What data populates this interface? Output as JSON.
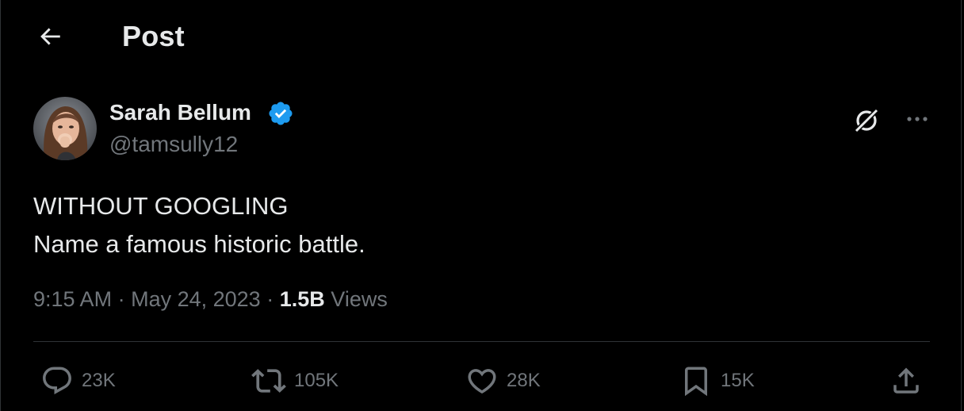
{
  "header": {
    "title": "Post",
    "back_icon": "arrow-left-icon"
  },
  "author": {
    "name": "Sarah Bellum",
    "handle": "@tamsully12",
    "verified": true,
    "verified_color": "#1d9bf0"
  },
  "tweet": {
    "lines": [
      "WITHOUT GOOGLING",
      "Name a famous historic battle."
    ],
    "time": "9:15 AM",
    "separator": "·",
    "date": "May 24, 2023",
    "views_count": "1.5B",
    "views_label": "Views"
  },
  "actions": {
    "reply": {
      "icon": "reply-icon",
      "count": "23K"
    },
    "retweet": {
      "icon": "retweet-icon",
      "count": "105K"
    },
    "like": {
      "icon": "heart-icon",
      "count": "28K"
    },
    "bookmark": {
      "icon": "bookmark-icon",
      "count": "15K"
    },
    "share": {
      "icon": "share-icon"
    }
  },
  "colors": {
    "background": "#000000",
    "text_primary": "#e7e9ea",
    "text_secondary": "#71767b",
    "divider": "#2f3336"
  }
}
